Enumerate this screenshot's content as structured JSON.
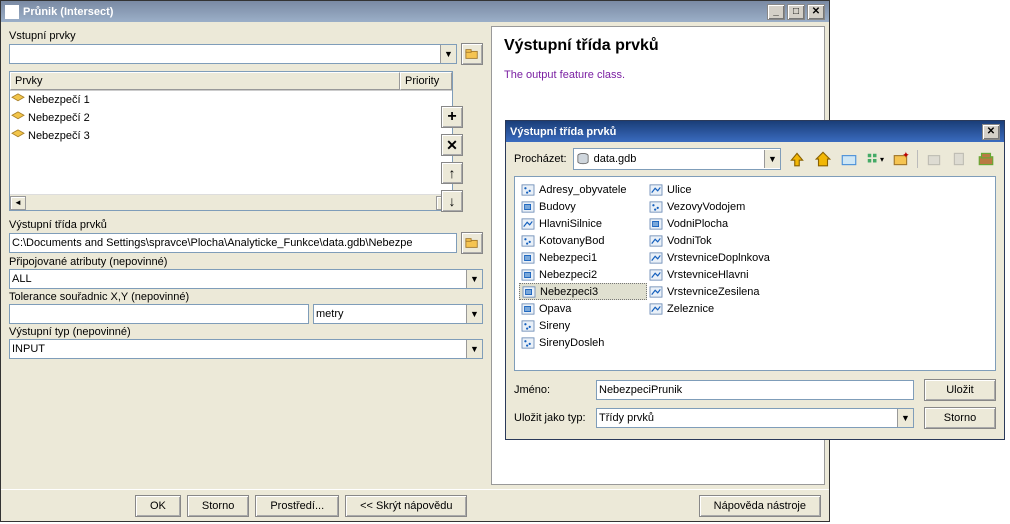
{
  "main": {
    "title": "Průnik (Intersect)",
    "input_label": "Vstupní prvky",
    "input_value": "",
    "table": {
      "headers": [
        "Prvky",
        "Priority"
      ],
      "rows": [
        "Nebezpečí 1",
        "Nebezpečí 2",
        "Nebezpečí 3"
      ]
    },
    "output_label": "Výstupní třída prvků",
    "output_value": "C:\\Documents and Settings\\spravce\\Plocha\\Analyticke_Funkce\\data.gdb\\Nebezpe",
    "join_label": "Připojované atributy (nepovinné)",
    "join_value": "ALL",
    "tol_label": "Tolerance souřadnic X,Y (nepovinné)",
    "tol_value": "",
    "tol_unit": "metry",
    "outtype_label": "Výstupní typ (nepovinné)",
    "outtype_value": "INPUT",
    "buttons": {
      "ok": "OK",
      "cancel": "Storno",
      "env": "Prostředí...",
      "hidehelp": "<< Skrýt nápovědu",
      "toolhelp": "Nápověda nástroje"
    }
  },
  "help": {
    "title": "Výstupní třída prvků",
    "desc": "The output feature class."
  },
  "save": {
    "title": "Výstupní třída prvků",
    "browse_label": "Procházet:",
    "browse_value": "data.gdb",
    "name_label": "Jméno:",
    "name_value": "NebezpeciPrunik",
    "type_label": "Uložit jako typ:",
    "type_value": "Třídy prvků",
    "save_btn": "Uložit",
    "cancel_btn": "Storno",
    "files_left": [
      {
        "n": "Adresy_obyvatele",
        "t": "pt"
      },
      {
        "n": "Budovy",
        "t": "poly"
      },
      {
        "n": "HlavniSilnice",
        "t": "line"
      },
      {
        "n": "KotovanyBod",
        "t": "pt"
      },
      {
        "n": "Nebezpeci1",
        "t": "poly"
      },
      {
        "n": "Nebezpeci2",
        "t": "poly"
      },
      {
        "n": "Nebezpeci3",
        "t": "poly",
        "sel": true
      },
      {
        "n": "Opava",
        "t": "poly"
      },
      {
        "n": "Sireny",
        "t": "pt"
      }
    ],
    "files_right": [
      {
        "n": "SirenyDosleh",
        "t": "pt"
      },
      {
        "n": "Ulice",
        "t": "line"
      },
      {
        "n": "VezovyVodojem",
        "t": "pt"
      },
      {
        "n": "VodniPlocha",
        "t": "poly"
      },
      {
        "n": "VodniTok",
        "t": "line"
      },
      {
        "n": "VrstevniceDoplnkova",
        "t": "line"
      },
      {
        "n": "VrstevniceHlavni",
        "t": "line"
      },
      {
        "n": "VrstevniceZesilena",
        "t": "line"
      },
      {
        "n": "Zeleznice",
        "t": "line"
      }
    ]
  }
}
